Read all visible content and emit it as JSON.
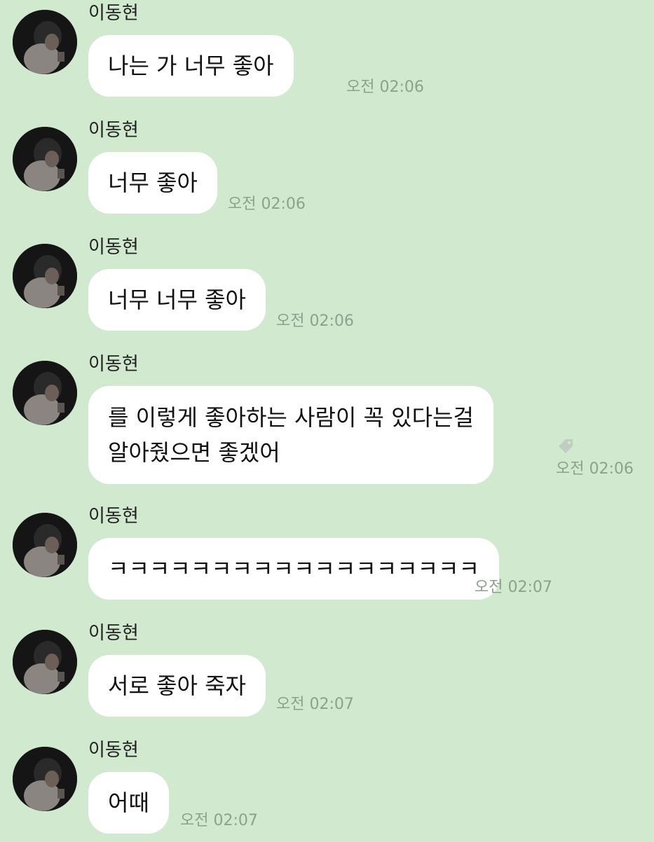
{
  "chat": {
    "messages": [
      {
        "sender": "이동현",
        "text": "나는         가 너무 좋아",
        "time": "오전 02:06"
      },
      {
        "sender": "이동현",
        "text": "너무 좋아",
        "time": "오전 02:06"
      },
      {
        "sender": "이동현",
        "text": "너무 너무 좋아",
        "time": "오전 02:06"
      },
      {
        "sender": "이동현",
        "text_line1": "  를 이렇게 좋아하는 사람이 꼭 있다는걸",
        "text_line2": "알아줬으면 좋겠어",
        "time": "오전 02:06",
        "icon": "tag-icon"
      },
      {
        "sender": "이동현",
        "text": "ㅋㅋㅋㅋㅋㅋㅋㅋㅋㅋㅋㅋㅋㅋㅋㅋㅋㅋ",
        "time": "오전 02:07"
      },
      {
        "sender": "이동현",
        "text": "서로 좋아 죽자",
        "time": "오전 02:07"
      },
      {
        "sender": "이동현",
        "text": "어때",
        "time": "오전 02:07"
      }
    ]
  },
  "colors": {
    "background": "#d0e9cf",
    "bubble": "#ffffff",
    "timestamp": "#8da18c"
  }
}
